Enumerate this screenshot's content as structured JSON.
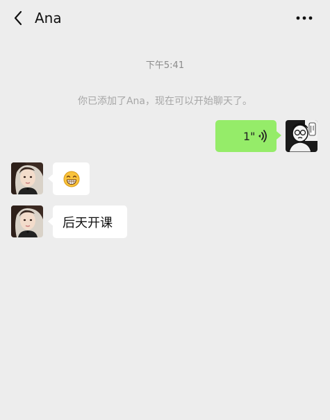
{
  "header": {
    "title": "Ana",
    "back_icon": "back-chevron-icon",
    "more_icon": "more-dots-icon"
  },
  "chat": {
    "timestamp": "下午5:41",
    "system_notice": "你已添加了Ana，现在可以开始聊天了。",
    "messages": [
      {
        "direction": "sent",
        "type": "voice",
        "duration": "1\"",
        "icon": "voice-wave-icon"
      },
      {
        "direction": "received",
        "type": "emoji",
        "emoji": "😁"
      },
      {
        "direction": "received",
        "type": "text",
        "text": "后天开课"
      }
    ]
  },
  "colors": {
    "background": "#ededed",
    "sent_bubble": "#95ec69",
    "received_bubble": "#ffffff"
  }
}
